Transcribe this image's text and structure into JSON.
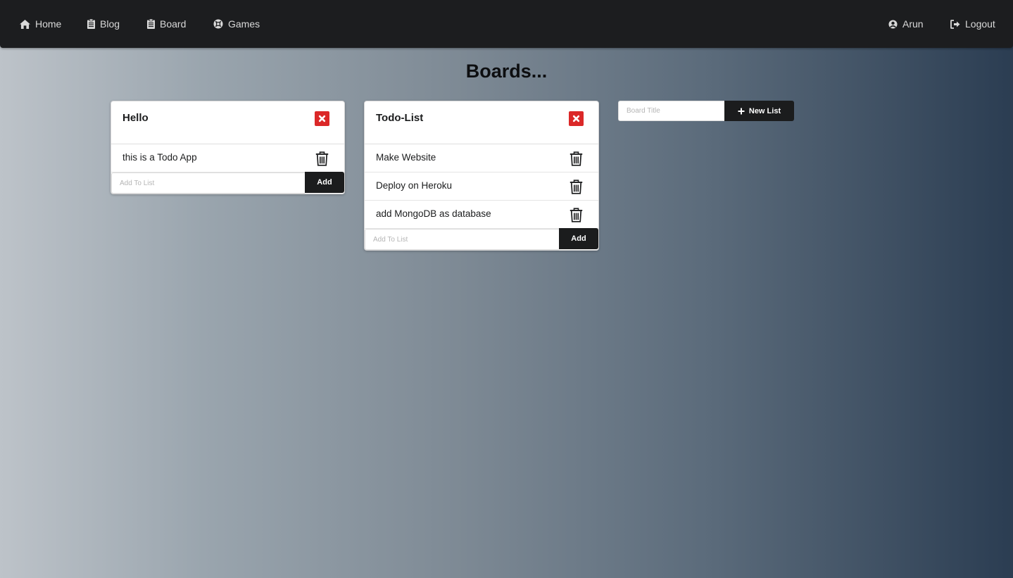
{
  "nav": {
    "home": "Home",
    "blog": "Blog",
    "board": "Board",
    "games": "Games",
    "user": "Arun",
    "logout": "Logout"
  },
  "page": {
    "title": "Boards..."
  },
  "boards": [
    {
      "title": "Hello",
      "items": [
        "this is a Todo App"
      ],
      "add_placeholder": "Add To List",
      "add_label": "Add"
    },
    {
      "title": "Todo-List",
      "items": [
        "Make Website",
        "Deploy on Heroku",
        "add MongoDB as database"
      ],
      "add_placeholder": "Add To List",
      "add_label": "Add"
    }
  ],
  "new_list": {
    "placeholder": "Board Title",
    "button_label": "New List"
  },
  "colors": {
    "navbar": "#1c1d1f",
    "close_button": "#db2828",
    "dark_button": "#1b1c1d"
  },
  "icons": {
    "home": "home-icon",
    "blog": "clipboard-icon",
    "board": "clipboard-icon",
    "games": "xbox-icon",
    "user": "user-circle-icon",
    "logout": "sign-out-icon",
    "close": "close-icon",
    "delete": "trash-icon",
    "add": "plus-icon"
  }
}
